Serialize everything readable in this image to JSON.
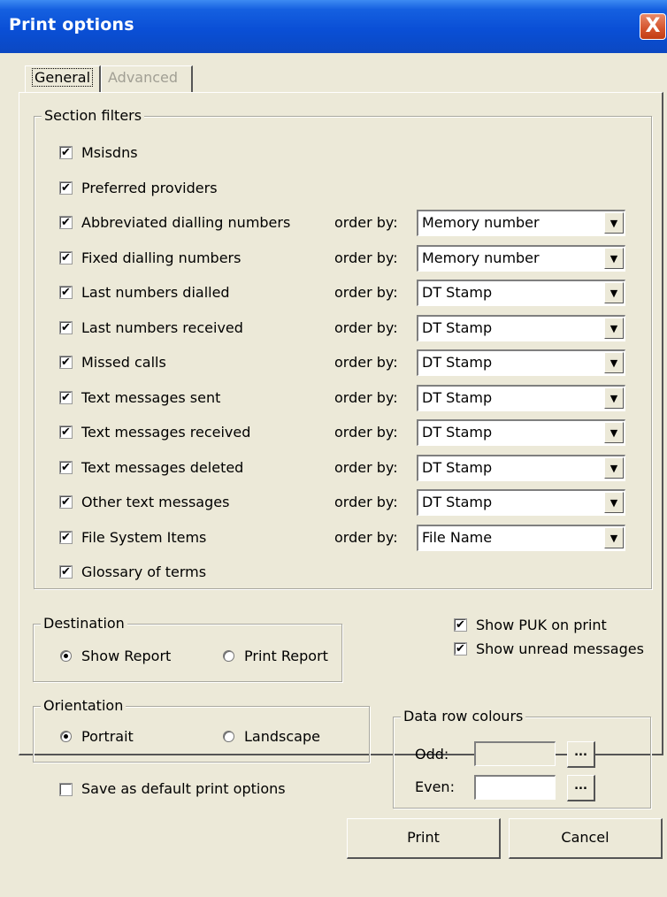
{
  "window": {
    "title": "Print options",
    "close_glyph": "X"
  },
  "tabs": [
    {
      "label": "General"
    },
    {
      "label": "Advanced"
    }
  ],
  "section_filters": {
    "legend": "Section filters",
    "items": [
      {
        "label": "Msisdns",
        "checked": true
      },
      {
        "label": "Preferred providers",
        "checked": true
      },
      {
        "label": "Abbreviated dialling numbers",
        "checked": true,
        "order_by_label": "order by:",
        "order_by": "Memory number"
      },
      {
        "label": "Fixed dialling numbers",
        "checked": true,
        "order_by_label": "order by:",
        "order_by": "Memory number"
      },
      {
        "label": "Last numbers dialled",
        "checked": true,
        "order_by_label": "order by:",
        "order_by": "DT Stamp"
      },
      {
        "label": "Last numbers received",
        "checked": true,
        "order_by_label": "order by:",
        "order_by": "DT Stamp"
      },
      {
        "label": "Missed calls",
        "checked": true,
        "order_by_label": "order by:",
        "order_by": "DT Stamp"
      },
      {
        "label": "Text messages sent",
        "checked": true,
        "order_by_label": "order by:",
        "order_by": "DT Stamp"
      },
      {
        "label": "Text messages received",
        "checked": true,
        "order_by_label": "order by:",
        "order_by": "DT Stamp"
      },
      {
        "label": "Text messages deleted",
        "checked": true,
        "order_by_label": "order by:",
        "order_by": "DT Stamp"
      },
      {
        "label": "Other text messages",
        "checked": true,
        "order_by_label": "order by:",
        "order_by": "DT Stamp"
      },
      {
        "label": "File System Items",
        "checked": true,
        "order_by_label": "order by:",
        "order_by": "File Name"
      },
      {
        "label": "Glossary of terms",
        "checked": true
      }
    ]
  },
  "destination": {
    "legend": "Destination",
    "options": [
      {
        "label": "Show Report",
        "selected": true
      },
      {
        "label": "Print Report",
        "selected": false
      }
    ]
  },
  "orientation": {
    "legend": "Orientation",
    "options": [
      {
        "label": "Portrait",
        "selected": true
      },
      {
        "label": "Landscape",
        "selected": false
      }
    ]
  },
  "extra_options": [
    {
      "label": "Show PUK on print",
      "checked": true
    },
    {
      "label": "Show unread messages",
      "checked": true
    }
  ],
  "save_default": {
    "label": "Save as default print options",
    "checked": false
  },
  "data_row_colours": {
    "legend": "Data row colours",
    "odd_label": "Odd:",
    "odd_color": "#ece9d8",
    "even_label": "Even:",
    "even_color": "#ffffff",
    "ellipsis": "..."
  },
  "buttons": {
    "print": "Print",
    "cancel": "Cancel"
  },
  "glyphs": {
    "check": "✔",
    "dropdown": "▼"
  }
}
